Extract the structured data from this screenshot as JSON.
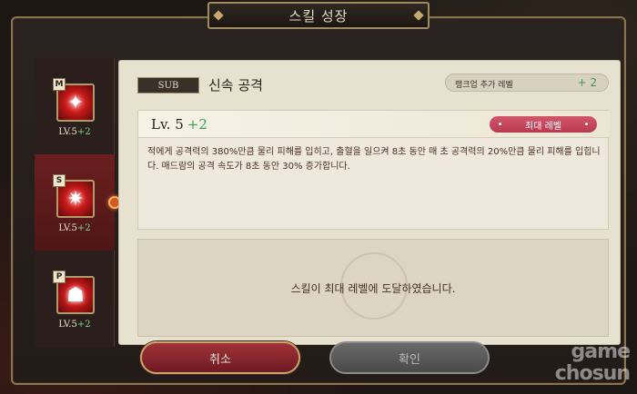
{
  "window": {
    "title": "스킬 성장"
  },
  "skills": [
    {
      "type": "M",
      "level_prefix": "LV.",
      "level": "5",
      "plus": "+2",
      "glyph": "✦"
    },
    {
      "type": "S",
      "level_prefix": "LV.",
      "level": "5",
      "plus": "+2",
      "glyph": "✷"
    },
    {
      "type": "P",
      "level_prefix": "LV.",
      "level": "5",
      "plus": "+2",
      "glyph": "☗"
    }
  ],
  "detail": {
    "sub_label": "SUB",
    "skill_name": "신속 공격",
    "rank_label": "랭크업 추가 레벨",
    "rank_value": "+ 2",
    "level_label": "Lv. 5",
    "level_plus": "+2",
    "max_badge": "최대 레벨",
    "description": "적에게 공격력의 380%만큼 물리 피해를 입히고, 출혈을 일으켜 8초 동안 매 초 공격력의 20%만큼 물리 피해를 입힙니다. 매드람의 공격 속도가 8초 동안 30% 증가합니다.",
    "max_message": "스킬이 최대 레벨에 도달하였습니다."
  },
  "buttons": {
    "cancel": "취소",
    "confirm": "확인"
  },
  "watermark": {
    "line1": "game",
    "line2": "chosun"
  }
}
